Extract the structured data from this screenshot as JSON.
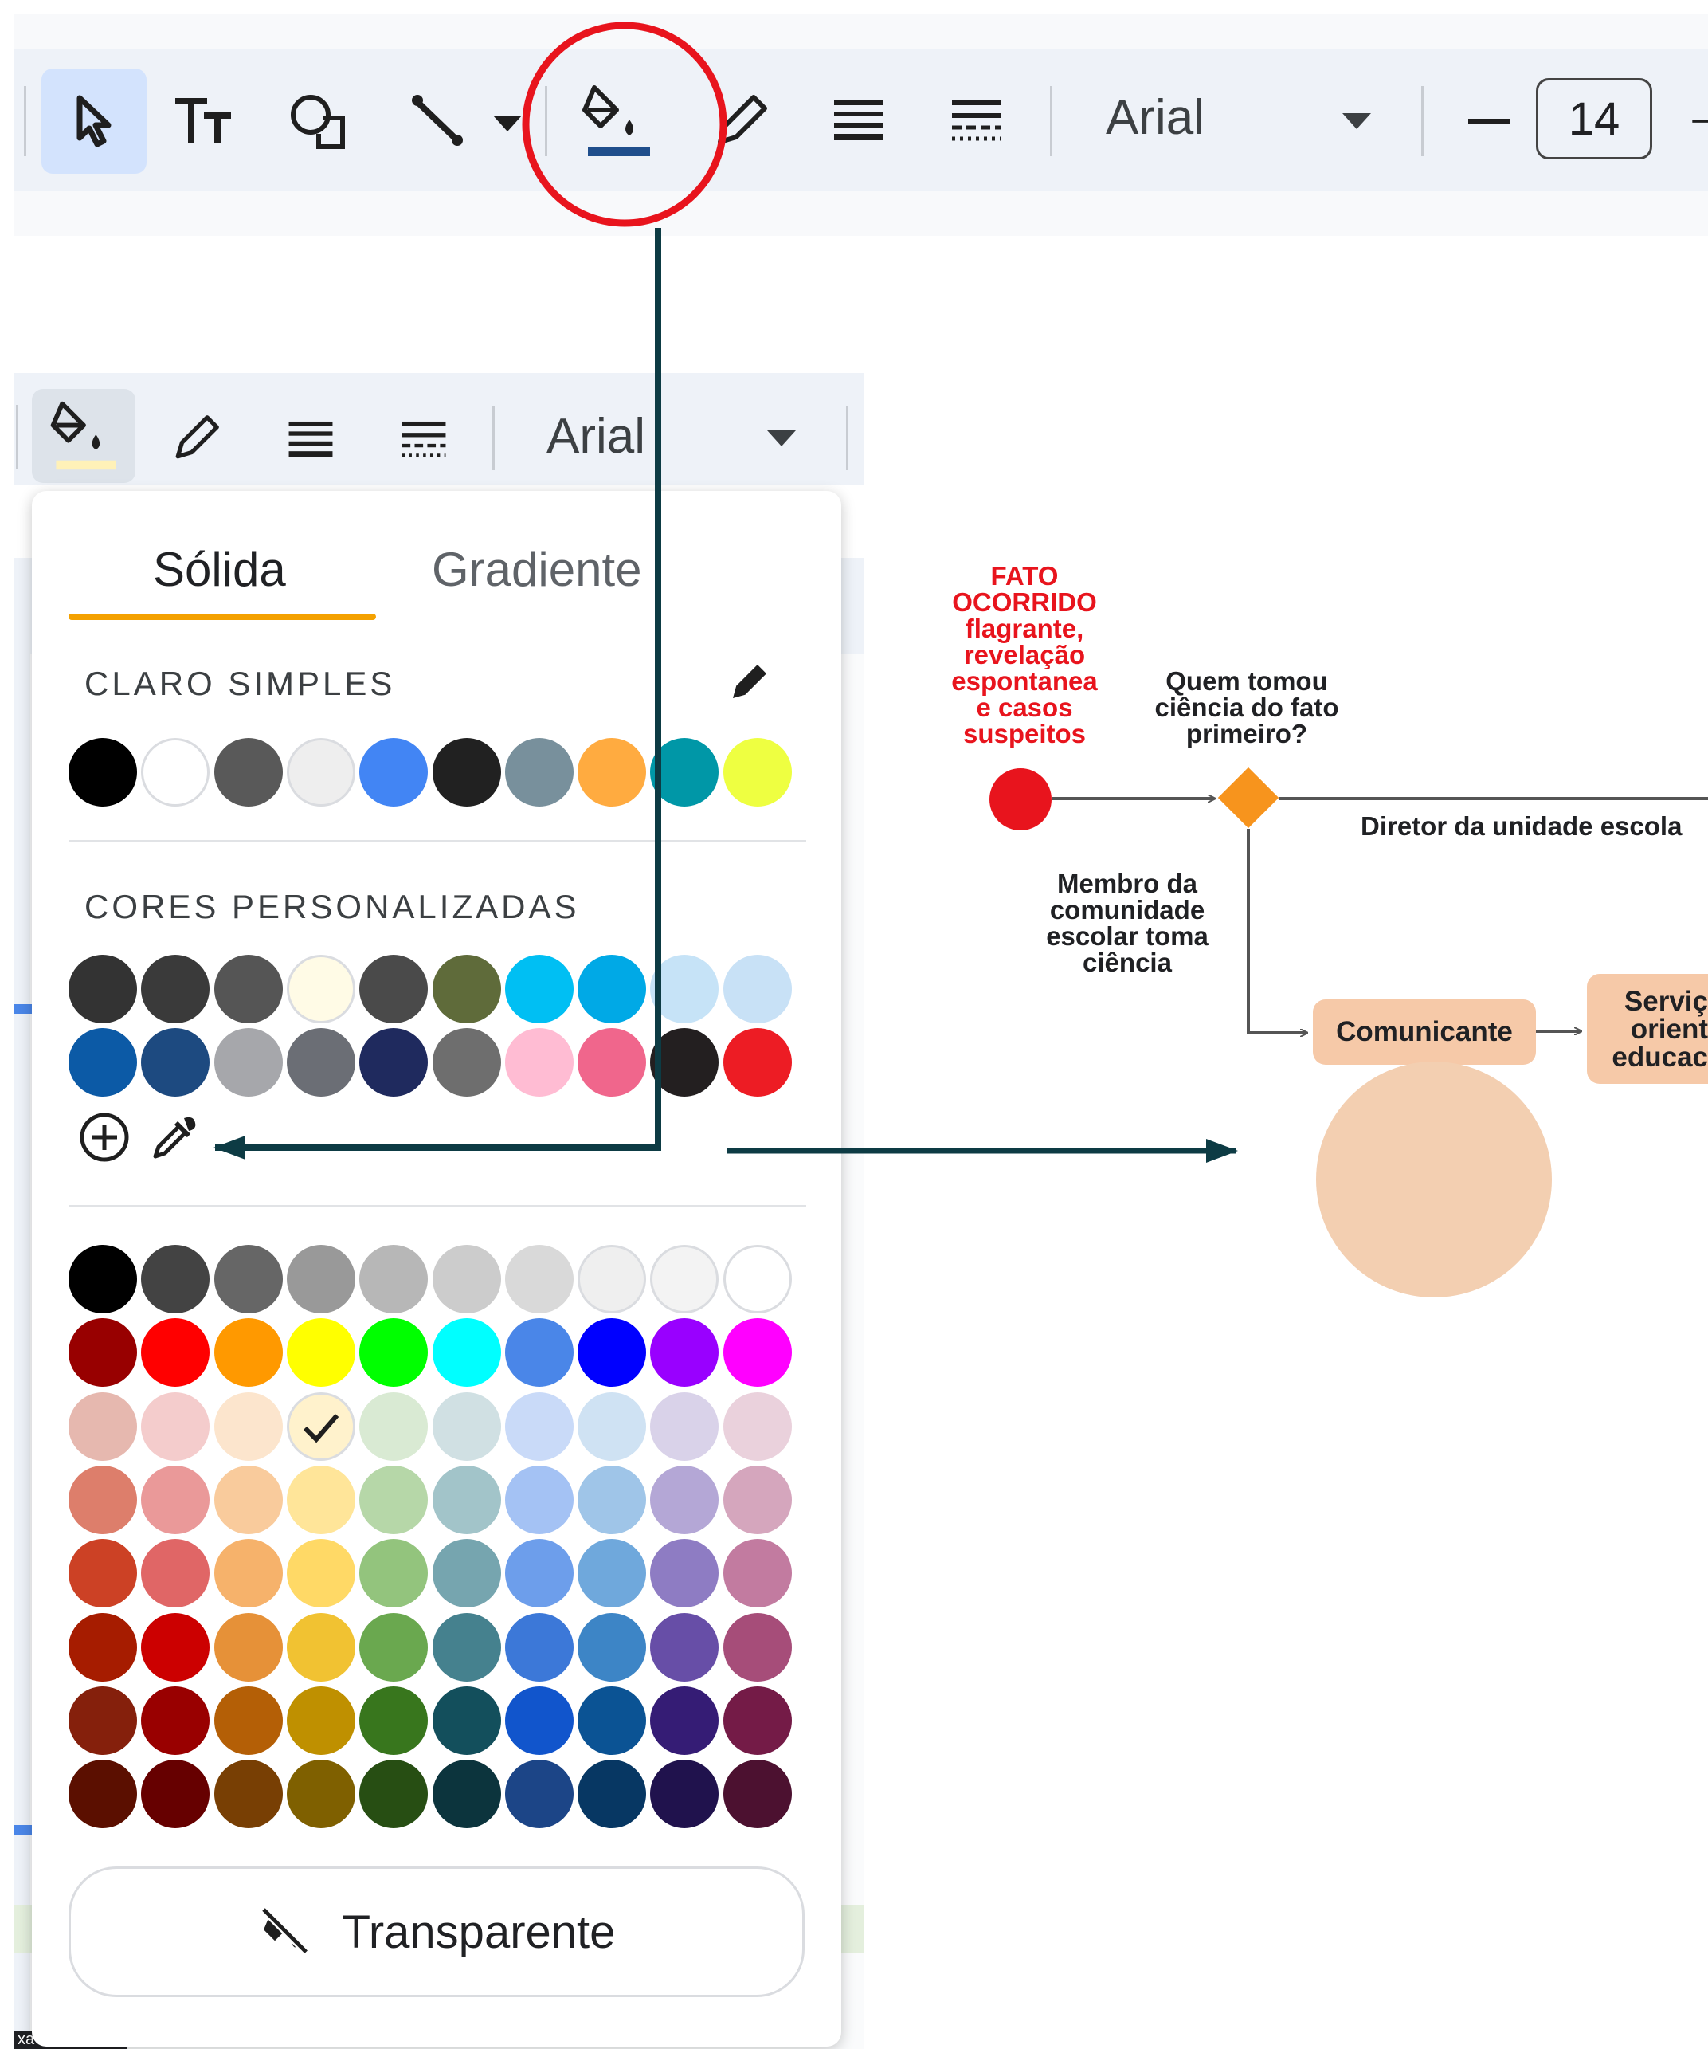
{
  "toolbar": {
    "font_name": "Arial",
    "font_size": "14",
    "fill_accent": "#1f4e8c",
    "icons": [
      "cursor-icon",
      "text-style-icon",
      "shapes-icon",
      "line-icon",
      "chevron-down-icon",
      "paint-bucket-icon",
      "pencil-icon",
      "line-weight-icon",
      "line-dash-icon",
      "chevron-down-icon",
      "minus-icon",
      "plus-icon"
    ]
  },
  "sub_toolbar": {
    "font_name": "Arial",
    "fill_accent": "#fff1b8"
  },
  "picker": {
    "tab_solid": "Sólida",
    "tab_gradient": "Gradiente",
    "section_simple": "CLARO SIMPLES",
    "section_custom": "CORES PERSONALIZADAS",
    "transparent_label": "Transparente",
    "simple_colors": [
      "#000000",
      "#ffffff",
      "#595959",
      "#eeeeee",
      "#4285f4",
      "#212121",
      "#78909c",
      "#ffab40",
      "#0097a7",
      "#eeff41"
    ],
    "custom_colors": [
      [
        "#333333",
        "#3a3a3a",
        "#555555",
        "#fffbe6",
        "#4a4a4a",
        "#5f6b3a",
        "#00bff3",
        "#00a9e6",
        "#c6e3f7",
        "#c8e1f6"
      ],
      [
        "#0c5aa6",
        "#1d4a80",
        "#a6a7ab",
        "#6b6e75",
        "#1f2a5e",
        "#6e6e6e",
        "#ffbcd3",
        "#f0668c",
        "#231f20",
        "#ed1c24"
      ]
    ],
    "grid_colors": [
      [
        "#000000",
        "#434343",
        "#666666",
        "#999999",
        "#b7b7b7",
        "#cccccc",
        "#d9d9d9",
        "#efefef",
        "#f3f3f3",
        "#ffffff"
      ],
      [
        "#980000",
        "#ff0000",
        "#ff9900",
        "#ffff00",
        "#00ff00",
        "#00ffff",
        "#4a86e8",
        "#0000ff",
        "#9900ff",
        "#ff00ff"
      ],
      [
        "#e6b8af",
        "#f4cccc",
        "#fce5cd",
        "#fff2cc",
        "#d9ead3",
        "#d0e0e3",
        "#c9daf8",
        "#cfe2f3",
        "#d9d2e9",
        "#ead1dc"
      ],
      [
        "#dd7e6b",
        "#ea9999",
        "#f9cb9c",
        "#ffe599",
        "#b6d7a8",
        "#a2c4c9",
        "#a4c2f4",
        "#9fc5e8",
        "#b4a7d6",
        "#d5a6bd"
      ],
      [
        "#cc4125",
        "#e06666",
        "#f6b26b",
        "#ffd966",
        "#93c47d",
        "#76a5af",
        "#6d9eeb",
        "#6fa8dc",
        "#8e7cc3",
        "#c27ba0"
      ],
      [
        "#a61c00",
        "#cc0000",
        "#e69138",
        "#f1c232",
        "#6aa84f",
        "#45818e",
        "#3c78d8",
        "#3d85c6",
        "#674ea7",
        "#a64d79"
      ],
      [
        "#85200c",
        "#990000",
        "#b45f06",
        "#bf9000",
        "#38761d",
        "#134f5c",
        "#1155cc",
        "#0b5394",
        "#351c75",
        "#741b47"
      ],
      [
        "#5b0f00",
        "#660000",
        "#783f04",
        "#7f6000",
        "#274e13",
        "#0c343d",
        "#1c4587",
        "#073763",
        "#20124d",
        "#4c1130"
      ]
    ],
    "selected_color": "#fff2cc"
  },
  "flowchart": {
    "start_label": "FATO\nOCORRIDO\nflagrante,\nrevelação\nespontanea\ne casos\nsuspeitos",
    "question": "Quem tomou\nciência do fato\nprimeiro?",
    "branch_right": "Diretor da unidade escola",
    "branch_down": "Membro da\ncomunidade\nescolar toma\nciência",
    "box_comunicante": "Comunicante",
    "box_servico": "Serviç\norient\neducac",
    "start_color": "#e8141d",
    "decision_color": "#f7941d",
    "box_color": "#f6c9a8",
    "highlight_color": "#f3cfb1"
  },
  "annotation": {
    "circle_color": "#e8141d",
    "arrow_color": "#0d3b44"
  },
  "bottom_tooltip": "xa de texto"
}
